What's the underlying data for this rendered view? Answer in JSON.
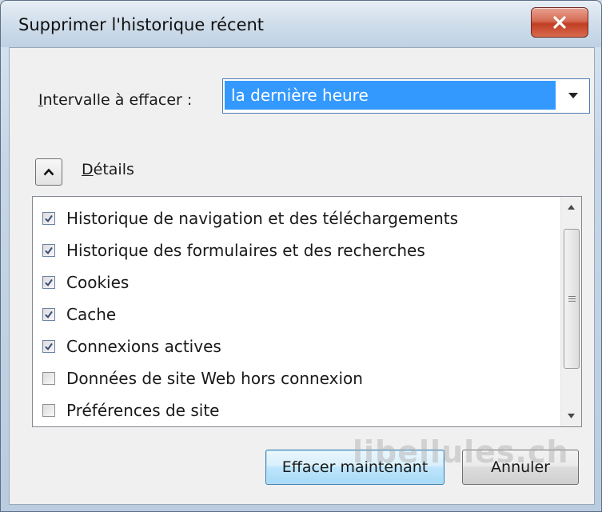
{
  "window": {
    "title": "Supprimer l'historique récent",
    "close_label": "x"
  },
  "interval": {
    "label_underlined": "I",
    "label_rest": "ntervalle à effacer :",
    "selected_value": "la dernière heure",
    "highlight_color": "#3399ff"
  },
  "details": {
    "label_underlined": "D",
    "label_rest": "étails",
    "toggle_icon": "chevron-up-icon"
  },
  "items": [
    {
      "label": "Historique de navigation et des téléchargements",
      "checked": true
    },
    {
      "label": "Historique des formulaires et des recherches",
      "checked": true
    },
    {
      "label": "Cookies",
      "checked": true
    },
    {
      "label": "Cache",
      "checked": true
    },
    {
      "label": "Connexions actives",
      "checked": true
    },
    {
      "label": "Données de site Web hors connexion",
      "checked": false
    },
    {
      "label": "Préférences de site",
      "checked": false
    }
  ],
  "buttons": {
    "clear_now": "Effacer maintenant",
    "cancel": "Annuler"
  },
  "watermark": "libellules.ch"
}
